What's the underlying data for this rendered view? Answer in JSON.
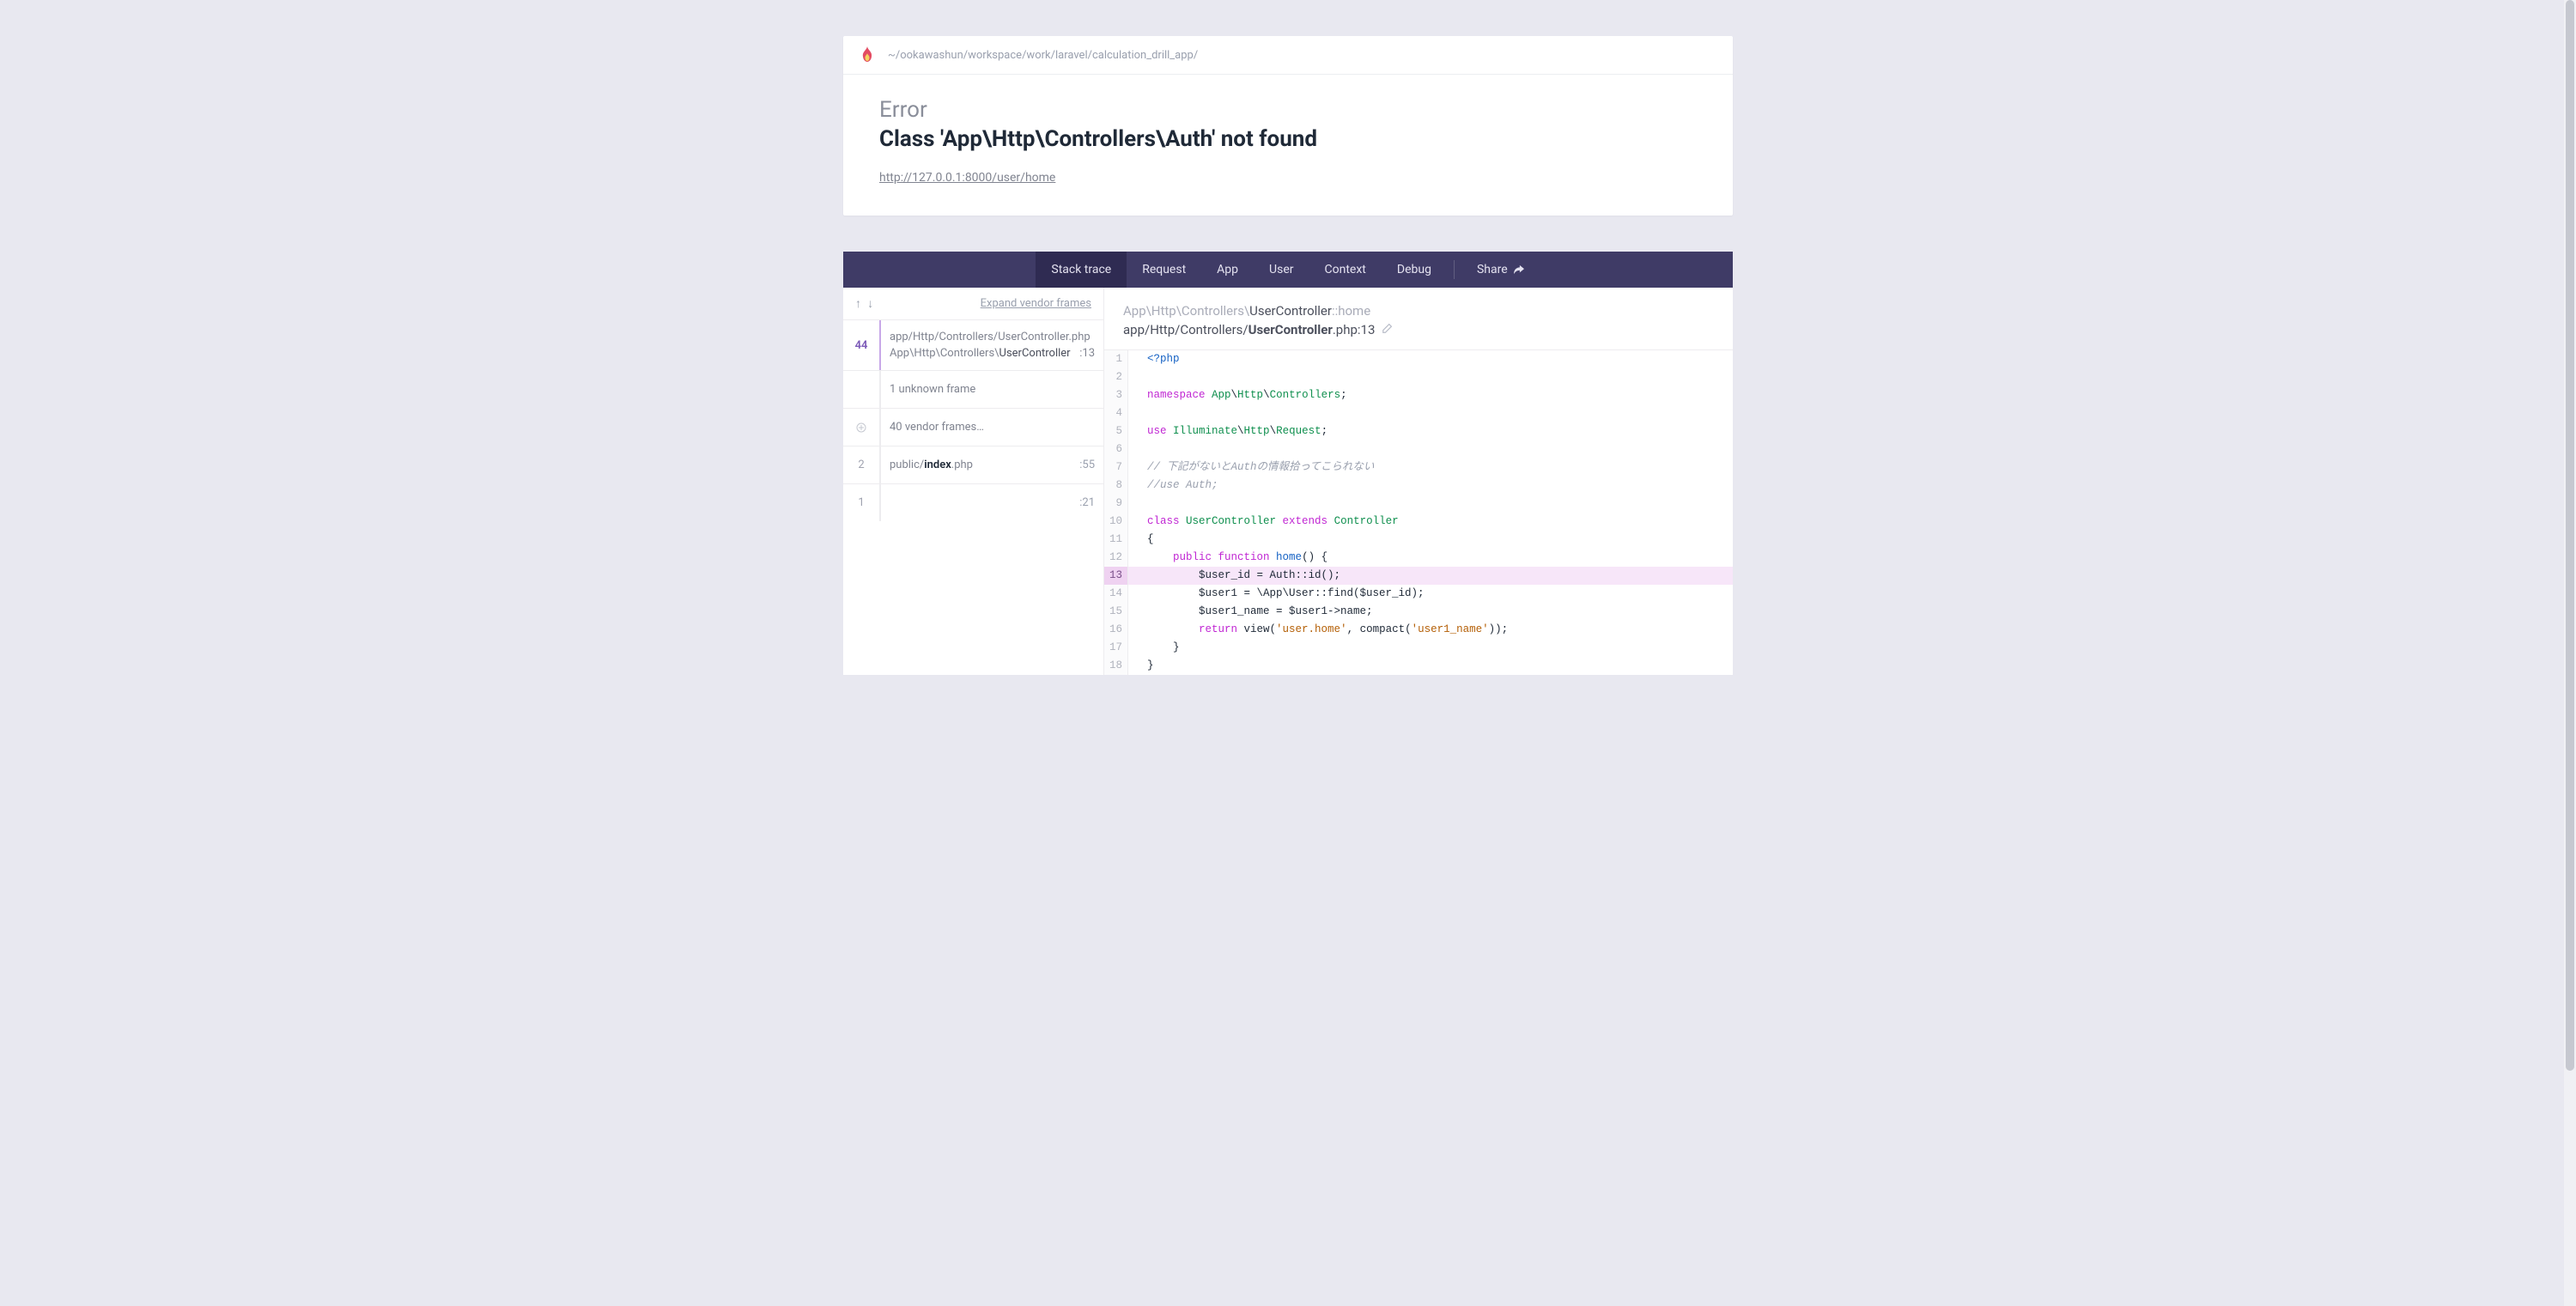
{
  "header": {
    "breadcrumb": "~/ookawashun/workspace/work/laravel/calculation_drill_app/"
  },
  "error": {
    "label": "Error",
    "title": "Class 'App\\Http\\Controllers\\Auth' not found",
    "url": "http://127.0.0.1:8000/user/home"
  },
  "tabs": {
    "items": [
      "Stack trace",
      "Request",
      "App",
      "User",
      "Context",
      "Debug"
    ],
    "share": "Share",
    "active_index": 0
  },
  "stack": {
    "expand_label": "Expand vendor frames",
    "frames": [
      {
        "num": "44",
        "highlighted": true,
        "title_prefix": "app/Http/Controllers/",
        "title_strong": "UserController",
        "title_suffix": ".php",
        "subtitle_prefix": "App\\Http\\Controllers\\",
        "subtitle_strong": "UserController",
        "line": ":13"
      },
      {
        "num": "",
        "body": "1 unknown frame"
      },
      {
        "num": "",
        "expand_icon": true,
        "body": "40 vendor frames…"
      },
      {
        "num": "2",
        "title_prefix": "public/",
        "title_strong": "index",
        "title_suffix": ".php",
        "line": ":55"
      },
      {
        "num": "1",
        "body": "",
        "line": ":21"
      }
    ]
  },
  "source": {
    "class_prefix": "App\\Http\\Controllers\\",
    "class_strong": "UserController",
    "class_method": "::home",
    "file_prefix": "app/Http/Controllers/",
    "file_strong": "UserController",
    "file_suffix": ".php:13",
    "highlight_line": 13,
    "lines": [
      {
        "n": 1,
        "tokens": [
          [
            "tk-php",
            "<?php"
          ]
        ]
      },
      {
        "n": 2,
        "tokens": []
      },
      {
        "n": 3,
        "tokens": [
          [
            "tk-kw",
            "namespace "
          ],
          [
            "tk-ns",
            "App"
          ],
          [
            "",
            "\\"
          ],
          [
            "tk-ns",
            "Http"
          ],
          [
            "",
            "\\"
          ],
          [
            "tk-ns",
            "Controllers"
          ],
          [
            "",
            ";"
          ]
        ]
      },
      {
        "n": 4,
        "tokens": []
      },
      {
        "n": 5,
        "tokens": [
          [
            "tk-kw",
            "use "
          ],
          [
            "tk-ns",
            "Illuminate"
          ],
          [
            "",
            "\\"
          ],
          [
            "tk-ns",
            "Http"
          ],
          [
            "",
            "\\"
          ],
          [
            "tk-ns",
            "Request"
          ],
          [
            "",
            ";"
          ]
        ]
      },
      {
        "n": 6,
        "tokens": []
      },
      {
        "n": 7,
        "tokens": [
          [
            "tk-cmt",
            "// 下記がないとAuthの情報拾ってこられない"
          ]
        ]
      },
      {
        "n": 8,
        "tokens": [
          [
            "tk-cmt",
            "//use Auth;"
          ]
        ]
      },
      {
        "n": 9,
        "tokens": []
      },
      {
        "n": 10,
        "tokens": [
          [
            "tk-kw",
            "class "
          ],
          [
            "tk-cls",
            "UserController"
          ],
          [
            "tk-kw",
            " extends "
          ],
          [
            "tk-cls",
            "Controller"
          ]
        ]
      },
      {
        "n": 11,
        "tokens": [
          [
            "",
            "{"
          ]
        ]
      },
      {
        "n": 12,
        "tokens": [
          [
            "",
            "    "
          ],
          [
            "tk-kw",
            "public "
          ],
          [
            "tk-kw",
            "function "
          ],
          [
            "tk-fn",
            "home"
          ],
          [
            "",
            "() {"
          ]
        ]
      },
      {
        "n": 13,
        "tokens": [
          [
            "",
            "        $user_id = Auth::id();"
          ]
        ]
      },
      {
        "n": 14,
        "tokens": [
          [
            "",
            "        $user1 = \\App\\User::find($user_id);"
          ]
        ]
      },
      {
        "n": 15,
        "tokens": [
          [
            "",
            "        $user1_name = $user1->name;"
          ]
        ]
      },
      {
        "n": 16,
        "tokens": [
          [
            "",
            "        "
          ],
          [
            "tk-kw",
            "return"
          ],
          [
            "",
            " view("
          ],
          [
            "tk-str",
            "'user.home'"
          ],
          [
            "",
            ", compact("
          ],
          [
            "tk-str",
            "'user1_name'"
          ],
          [
            "",
            "));"
          ]
        ]
      },
      {
        "n": 17,
        "tokens": [
          [
            "",
            "    }"
          ]
        ]
      },
      {
        "n": 18,
        "tokens": [
          [
            "",
            "}"
          ]
        ]
      }
    ]
  }
}
